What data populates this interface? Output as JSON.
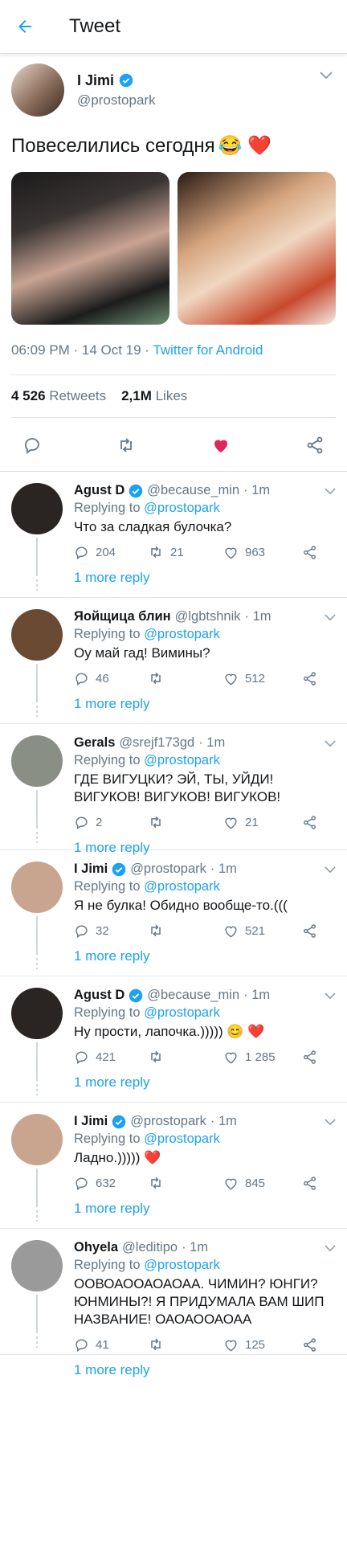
{
  "header": {
    "title": "Tweet"
  },
  "tweet": {
    "name": "I Jimi",
    "handle": "@prostopark",
    "text": "Повеселились сегодня",
    "text_emoji": "😂 ❤️",
    "time": "06:09 PM · 14 Oct 19 · ",
    "source": "Twitter for Android",
    "retweets": "4 526",
    "retweets_label": "Retweets",
    "likes": "2,1M",
    "likes_label": "Likes"
  },
  "replies": [
    {
      "name": "Agust D",
      "verified": true,
      "handle": "@because_min",
      "time": "· 1m",
      "replying": "Replying to ",
      "to": "@prostopark",
      "text": "Что за сладкая булочка?",
      "comments": "204",
      "retweets": "21",
      "likes": "963",
      "more": "1 more reply",
      "avatar_color": "#2a2522"
    },
    {
      "name": "Яойщица блин",
      "verified": false,
      "handle": "@lgbtshnik",
      "time": "· 1m",
      "replying": "Replying to ",
      "to": "@prostopark",
      "text": "Оу май гад! Вимины?",
      "comments": "46",
      "retweets": "",
      "likes": "512",
      "more": "1 more reply",
      "avatar_color": "#6b4a33"
    },
    {
      "name": "Gerals",
      "verified": false,
      "handle": "@srejf173gd",
      "time": "· 1m",
      "replying": "Replying to ",
      "to": "@prostopark",
      "text": "ГДЕ ВИГУЦКИ? ЭЙ, ТЫ, УЙДИ! ВИГУКОВ! ВИГУКОВ! ВИГУКОВ!",
      "comments": "2",
      "retweets": "",
      "likes": "21",
      "more": "1 more reply",
      "avatar_color": "#8a8f86"
    },
    {
      "name": "I Jimi",
      "verified": true,
      "handle": "@prostopark",
      "time": "· 1m",
      "replying": "Replying to ",
      "to": "@prostopark",
      "text": "Я не булка! Обидно вообще-то.(((",
      "comments": "32",
      "retweets": "",
      "likes": "521",
      "more": "1 more reply",
      "avatar_color": "#c9a48e"
    },
    {
      "name": "Agust D",
      "verified": true,
      "handle": "@because_min",
      "time": "· 1m",
      "replying": "Replying to ",
      "to": "@prostopark",
      "text": "Ну прости, лапочка.))))) 😊 ❤️",
      "comments": "421",
      "retweets": "",
      "likes": "1 285",
      "more": "1 more reply",
      "avatar_color": "#2a2522"
    },
    {
      "name": "I Jimi",
      "verified": true,
      "handle": "@prostopark",
      "time": "· 1m",
      "replying": "Replying to ",
      "to": "@prostopark",
      "text": "Ладно.))))) ❤️",
      "comments": "632",
      "retweets": "",
      "likes": "845",
      "more": "1 more reply",
      "avatar_color": "#c9a48e"
    },
    {
      "name": "Ohyela",
      "verified": false,
      "handle": "@leditipo",
      "time": "· 1m",
      "replying": "Replying to ",
      "to": "@prostopark",
      "text": "ООВОАООАОАОАА. ЧИМИН? ЮНГИ? ЮНМИНЫ?! Я ПРИДУМАЛА ВАМ ШИП НАЗВАНИЕ! ОАОАООАОАА",
      "comments": "41",
      "retweets": "",
      "likes": "125",
      "more": "1 more reply",
      "avatar_color": "#9a9a9a"
    }
  ],
  "colors": {
    "accent": "#1da1f2",
    "like": "#e0245e",
    "muted": "#657786"
  }
}
